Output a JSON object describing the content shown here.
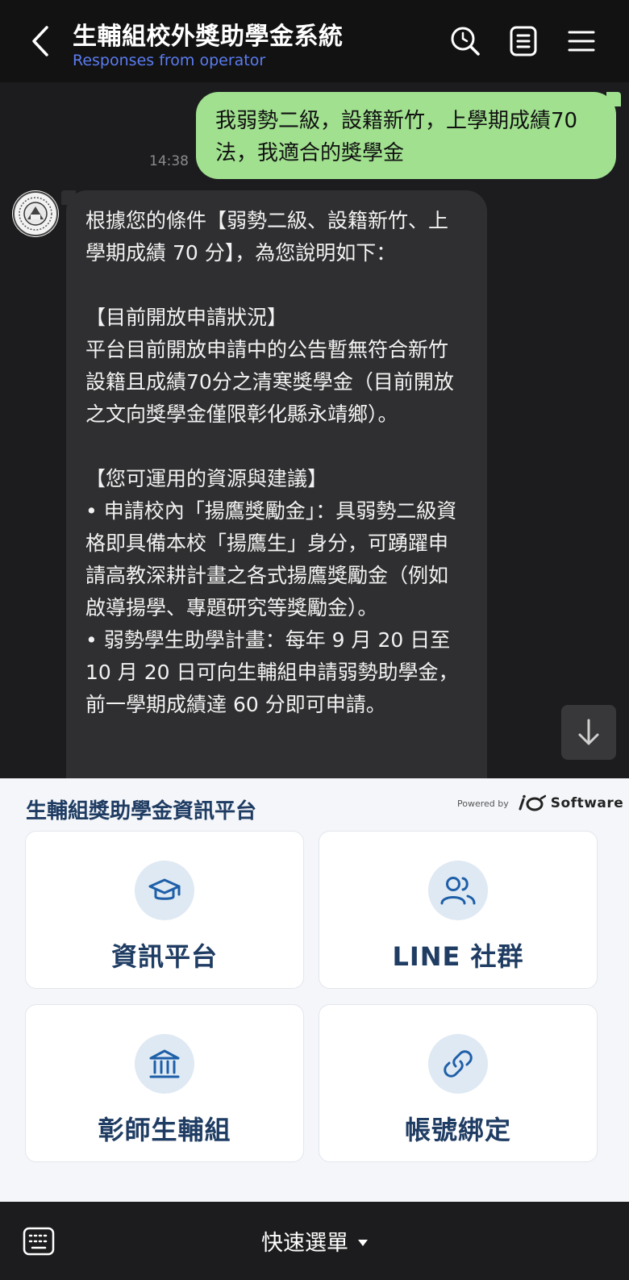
{
  "header": {
    "title": "生輔組校外獎助學金系統",
    "subtitle": "Responses from operator",
    "back_icon": "chevron-left-icon",
    "search_icon": "search-icon",
    "notes_icon": "notes-icon",
    "menu_icon": "hamburger-menu-icon"
  },
  "chat": {
    "user_message": "我弱勢二級，設籍新竹，上學期成績70法，我適合的獎學金",
    "user_time": "14:38",
    "bot_message": "根據您的條件【弱勢二級、設籍新竹、上學期成績 70 分】，為您說明如下：\n\n【目前開放申請狀況】\n平台目前開放申請中的公告暫無符合新竹設籍且成績70分之清寒獎學金（目前開放之文向獎學金僅限彰化縣永靖鄉）。\n\n【您可運用的資源與建議】\n• 申請校內「揚鷹獎勵金」：具弱勢二級資格即具備本校「揚鷹生」身分，可踴躍申請高教深耕計畫之各式揚鷹獎勵金（例如啟導揚學、專題研究等獎勵金）。\n• 弱勢學生助學計畫：每年 9 月 20 日至 10 月 20 日可向生輔組申請弱勢助學金，前一學期成績達 60 分即可申請。",
    "scroll_down_icon": "arrow-down-icon"
  },
  "rich_menu": {
    "title": "生輔組獎助學金資訊平台",
    "powered_by": "Powered by",
    "brand_name": "Software",
    "cards": [
      {
        "label": "資訊平台",
        "icon": "graduation-cap-icon"
      },
      {
        "label": "LINE 社群",
        "icon": "users-icon"
      },
      {
        "label": "彰師生輔組",
        "icon": "bank-building-icon"
      },
      {
        "label": "帳號綁定",
        "icon": "link-icon"
      }
    ]
  },
  "bottom_bar": {
    "keyboard_icon": "keyboard-icon",
    "quick_menu_label": "快速選單"
  },
  "colors": {
    "header_bg": "#121212",
    "chat_bg": "#1c1c1e",
    "user_bubble": "#a0e08f",
    "bot_bubble": "#2f2f31",
    "subtitle": "#5b7cf0",
    "menu_text": "#1f3c63",
    "icon_circle": "#dfe9f3"
  }
}
